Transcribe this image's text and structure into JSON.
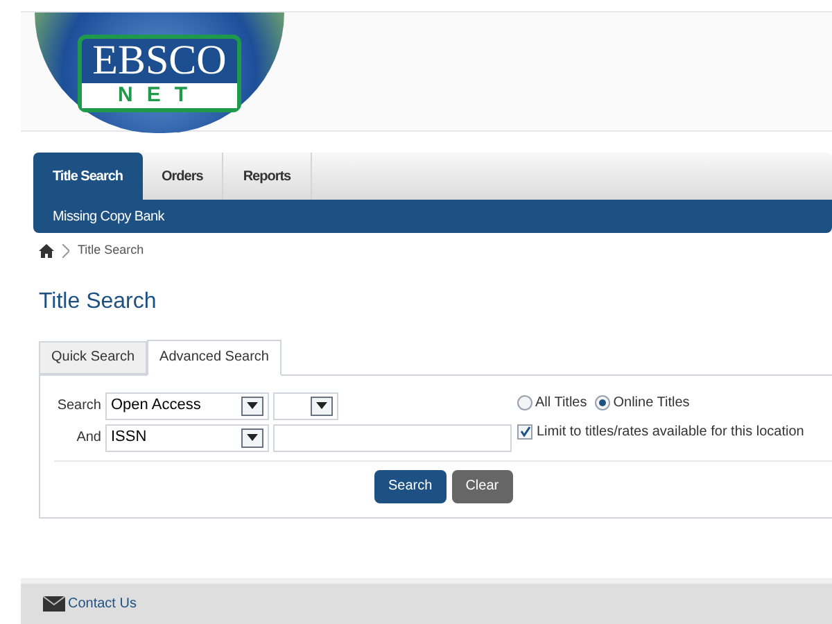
{
  "logo": {
    "top": "EBSCO",
    "bottom": "NET"
  },
  "nav": {
    "tabs": [
      {
        "label": "Title Search",
        "selected": true
      },
      {
        "label": "Orders",
        "selected": false
      },
      {
        "label": "Reports",
        "selected": false
      }
    ],
    "subnav": [
      "Missing Copy Bank"
    ]
  },
  "breadcrumb": [
    "Title Search"
  ],
  "page_title": "Title Search",
  "search_tabs": [
    {
      "label": "Quick Search",
      "selected": false
    },
    {
      "label": "Advanced Search",
      "selected": true
    }
  ],
  "form": {
    "rows": [
      {
        "label": "Search",
        "field": "Open Access",
        "kind": "select"
      },
      {
        "label": "And",
        "field": "ISSN",
        "kind": "text"
      }
    ],
    "scope": [
      {
        "label": "All Titles",
        "selected": false
      },
      {
        "label": "Online Titles",
        "selected": true
      }
    ],
    "limit": {
      "label": "Limit to titles/rates available for this location",
      "checked": true
    },
    "buttons": [
      {
        "label": "Search",
        "kind": "primary"
      },
      {
        "label": "Clear",
        "kind": "secondary"
      }
    ]
  },
  "footer": {
    "link": "Contact Us"
  }
}
